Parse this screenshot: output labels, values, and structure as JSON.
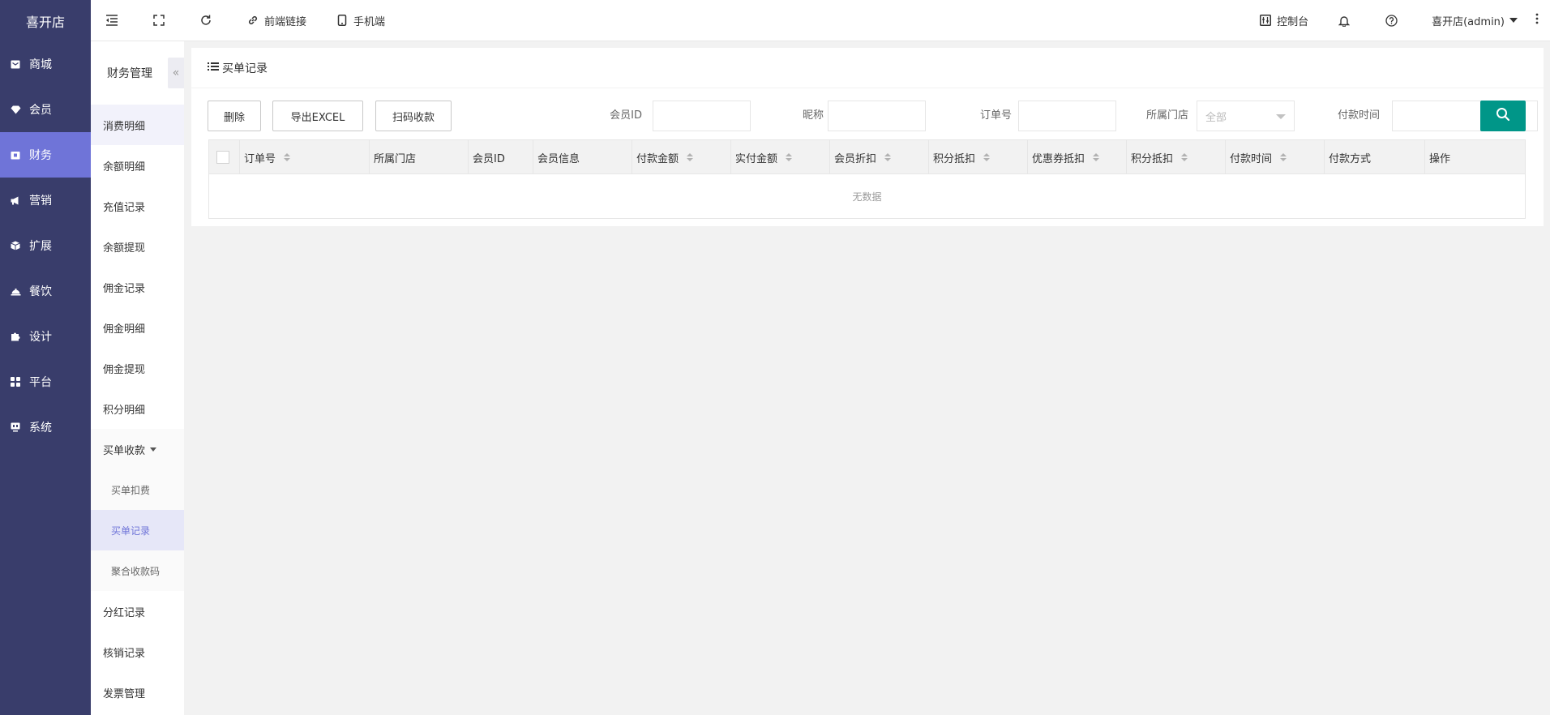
{
  "brand": "喜开店",
  "rail": {
    "items": [
      {
        "label": "商城",
        "icon": "mail-icon"
      },
      {
        "label": "会员",
        "icon": "diamond-icon"
      },
      {
        "label": "财务",
        "icon": "wallet-icon",
        "active": true
      },
      {
        "label": "营销",
        "icon": "megaphone-icon"
      },
      {
        "label": "扩展",
        "icon": "cube-icon"
      },
      {
        "label": "餐饮",
        "icon": "cloche-icon"
      },
      {
        "label": "设计",
        "icon": "puzzle-icon"
      },
      {
        "label": "平台",
        "icon": "grid-icon"
      },
      {
        "label": "系统",
        "icon": "monitor-icon"
      }
    ]
  },
  "subnav": {
    "title": "财务管理",
    "collapse_glyph": "«",
    "items": [
      "消费明细",
      "余额明细",
      "充值记录",
      "余额提现",
      "佣金记录",
      "佣金明细",
      "佣金提现",
      "积分明细"
    ],
    "group": "买单收款",
    "children": [
      "买单扣费",
      "买单记录",
      "聚合收款码"
    ],
    "after": [
      "分红记录",
      "核销记录",
      "发票管理"
    ]
  },
  "topbar": {
    "frontend_link": "前端链接",
    "mobile": "手机端",
    "console": "控制台",
    "user": "喜开店(admin)"
  },
  "page": {
    "title": "买单记录",
    "buttons": {
      "delete": "删除",
      "export": "导出EXCEL",
      "scan": "扫码收款"
    },
    "filters": {
      "member_id": "会员ID",
      "nickname": "昵称",
      "order_no": "订单号",
      "store": "所属门店",
      "store_value": "全部",
      "pay_time": "付款时间"
    },
    "columns": [
      {
        "label": "订单号",
        "sortable": true
      },
      {
        "label": "所属门店",
        "sortable": false
      },
      {
        "label": "会员ID",
        "sortable": false
      },
      {
        "label": "会员信息",
        "sortable": false
      },
      {
        "label": "付款金额",
        "sortable": true
      },
      {
        "label": "实付金额",
        "sortable": true
      },
      {
        "label": "会员折扣",
        "sortable": true
      },
      {
        "label": "积分抵扣",
        "sortable": true
      },
      {
        "label": "优惠券抵扣",
        "sortable": true
      },
      {
        "label": "积分抵扣",
        "sortable": true
      },
      {
        "label": "付款时间",
        "sortable": true
      },
      {
        "label": "付款方式",
        "sortable": false
      },
      {
        "label": "操作",
        "sortable": false
      }
    ],
    "empty_text": "无数据"
  },
  "colors": {
    "rail_bg": "#393d6b",
    "accent": "#6f74d8",
    "search_btn": "#009688"
  }
}
